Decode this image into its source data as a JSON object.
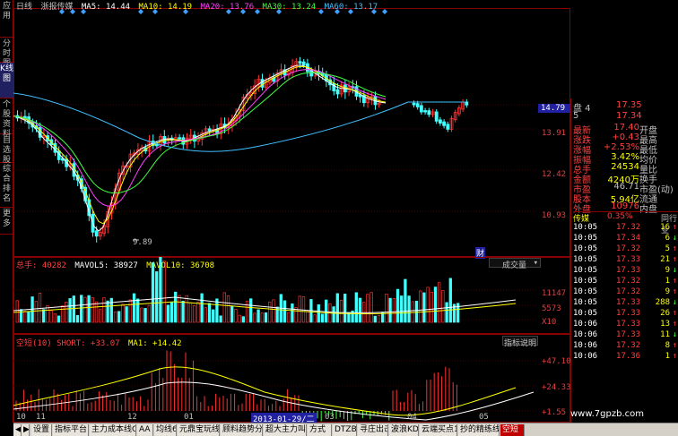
{
  "left_tabs": [
    {
      "label": "应用",
      "active": false
    },
    {
      "label": "分时图",
      "active": false
    },
    {
      "label": "K线图",
      "active": true
    },
    {
      "label": "个股资料",
      "active": false
    },
    {
      "label": "自选股",
      "active": false
    },
    {
      "label": "综合排名",
      "active": false
    },
    {
      "label": "更多",
      "active": false
    }
  ],
  "header": {
    "period": "日线",
    "stock_name": "浙报传媒",
    "ma5": "MA5: 14.44",
    "ma10": "MA10: 14.19",
    "ma20": "MA20: 13.76",
    "ma30": "MA30: 13.24",
    "ma60": "MA60: 13.17"
  },
  "price_axis": [
    "14.79",
    "13.91",
    "12.42",
    "10.93"
  ],
  "low_marker": "9.89",
  "cai_label": "财",
  "volume_panel": {
    "header_label": "总手: 40282",
    "mavol5": "MAVOL5: 38927",
    "mavol10": "MAVOL10: 36708",
    "dropdown": "成交量",
    "axis": [
      "11147",
      "5573",
      "X10"
    ]
  },
  "indicator_panel": {
    "header_label": "空短(10) SHORT: +33.07",
    "ma1": "MA1: +14.42",
    "help_button": "指标说明",
    "axis": [
      "+47.10",
      "+24.33",
      "+1.55"
    ]
  },
  "x_labels": [
    "10",
    "11",
    "12",
    "01",
    "03",
    "04",
    "05"
  ],
  "date_cursor": "2013-01-29/二",
  "order_book": [
    {
      "label": "盘 4",
      "price": "17.35"
    },
    {
      "label": "5",
      "price": "17.34"
    }
  ],
  "quote_info": [
    {
      "k1": "最新",
      "v1": "17.40",
      "k2": "开盘",
      "v2": "",
      "c": "#ff4040"
    },
    {
      "k1": "涨跌",
      "v1": "+0.43",
      "k2": "最高",
      "v2": "",
      "c": "#ff4040"
    },
    {
      "k1": "涨幅",
      "v1": "+2.53%",
      "k2": "最低",
      "v2": "",
      "c": "#ff4040"
    },
    {
      "k1": "振幅",
      "v1": "3.42%",
      "k2": "均价",
      "v2": "",
      "c": "#ffff00"
    },
    {
      "k1": "总手",
      "v1": "24534",
      "k2": "量比",
      "v2": "",
      "c": "#ffff00"
    },
    {
      "k1": "金额",
      "v1": "4240万",
      "k2": "换手",
      "v2": "",
      "c": "#ffff00"
    },
    {
      "k1": "市盈",
      "v1": "46.71",
      "k2": "市盈(动)",
      "v2": "",
      "c": "#c0c0c0"
    },
    {
      "k1": "股本",
      "v1": "5.94亿",
      "k2": "流通",
      "v2": "",
      "c": "#ffff00"
    },
    {
      "k1": "外盘",
      "v1": "10976",
      "k2": "内盘",
      "v2": "",
      "c": "#ff4040"
    }
  ],
  "sector": {
    "name": "传媒",
    "change": "0.35%",
    "rank_label": "同行业"
  },
  "ticks": [
    {
      "time": "10:05",
      "price": "17.32",
      "vol": "16"
    },
    {
      "time": "10:05",
      "price": "17.34",
      "vol": "6"
    },
    {
      "time": "10:05",
      "price": "17.32",
      "vol": "5"
    },
    {
      "time": "10:05",
      "price": "17.33",
      "vol": "21"
    },
    {
      "time": "10:05",
      "price": "17.33",
      "vol": "9"
    },
    {
      "time": "10:05",
      "price": "17.32",
      "vol": "1"
    },
    {
      "time": "10:05",
      "price": "17.32",
      "vol": "9"
    },
    {
      "time": "10:05",
      "price": "17.33",
      "vol": "288"
    },
    {
      "time": "10:05",
      "price": "17.33",
      "vol": "26"
    },
    {
      "time": "10:06",
      "price": "17.33",
      "vol": "13"
    },
    {
      "time": "10:06",
      "price": "17.33",
      "vol": "11"
    },
    {
      "time": "10:06",
      "price": "17.32",
      "vol": "8"
    },
    {
      "time": "10:06",
      "price": "17.36",
      "vol": "1"
    }
  ],
  "bottom_tabs": [
    {
      "label": "设置",
      "active": false
    },
    {
      "label": "指标平台",
      "active": false
    },
    {
      "label": "主力成本线C",
      "active": false
    },
    {
      "label": "AA",
      "active": false
    },
    {
      "label": "均线60",
      "active": false
    },
    {
      "label": "元鼎宝玩线",
      "active": false
    },
    {
      "label": "顾料趋势分析",
      "active": false
    },
    {
      "label": "超大主力叫时",
      "active": false
    },
    {
      "label": "方式",
      "active": false
    },
    {
      "label": "DTZB",
      "active": false
    },
    {
      "label": "寻庄出击",
      "active": false
    },
    {
      "label": "波浪KDJ",
      "active": false
    },
    {
      "label": "云端买点1",
      "active": false
    },
    {
      "label": "抄的精练线",
      "active": false
    },
    {
      "label": "空短",
      "active": true
    }
  ],
  "watermark": "www.7gpzb.com"
}
